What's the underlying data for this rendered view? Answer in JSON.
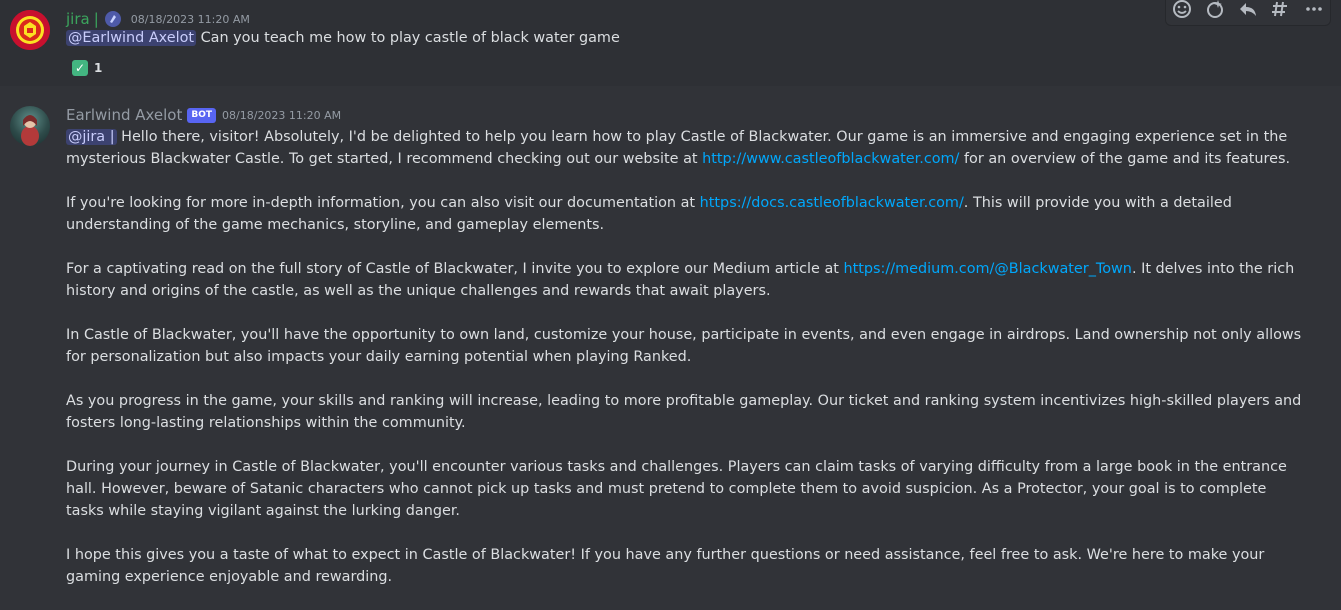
{
  "message1": {
    "username": "jira",
    "separator": "|",
    "timestamp": "08/18/2023 11:20 AM",
    "mention": "@Earlwind Axelot",
    "text": " Can you teach me how to play castle of black water game",
    "reaction": {
      "emoji": "white-check-mark",
      "count": "1"
    },
    "avatar": "manchester-united-crest"
  },
  "toolbar": {
    "icons": [
      "add-reaction-icon",
      "super-reaction-icon",
      "reply-icon",
      "create-thread-icon",
      "more-icon"
    ]
  },
  "message2": {
    "username": "Earlwind Axelot",
    "bot_tag": "BOT",
    "timestamp": "08/18/2023 11:20 AM",
    "mention": "@jira |",
    "p1_a": " Hello there, visitor! Absolutely, I'd be delighted to help you learn how to play Castle of Blackwater. Our game is an immersive and engaging experience set in the mysterious Blackwater Castle. To get started, I recommend checking out our website at ",
    "p1_link": "http://www.castleofblackwater.com/",
    "p1_b": " for an overview of the game and its features.",
    "p2_a": "If you're looking for more in-depth information, you can also visit our documentation at ",
    "p2_link": "https://docs.castleofblackwater.com/",
    "p2_b": ". This will provide you with a detailed understanding of the game mechanics, storyline, and gameplay elements.",
    "p3_a": "For a captivating read on the full story of Castle of Blackwater, I invite you to explore our Medium article at ",
    "p3_link": "https://medium.com/@Blackwater_Town",
    "p3_b": ". It delves into the rich history and origins of the castle, as well as the unique challenges and rewards that await players.",
    "p4": "In Castle of Blackwater, you'll have the opportunity to own land, customize your house, participate in events, and even engage in airdrops. Land ownership not only allows for personalization but also impacts your daily earning potential when playing Ranked.",
    "p5": "As you progress in the game, your skills and ranking will increase, leading to more profitable gameplay. Our ticket and ranking system incentivizes high-skilled players and fosters long-lasting relationships within the community.",
    "p6": "During your journey in Castle of Blackwater, you'll encounter various tasks and challenges. Players can claim tasks of varying difficulty from a large book in the entrance hall. However, beware of Satanic characters who cannot pick up tasks and must pretend to complete them to avoid suspicion. As a Protector, your goal is to complete tasks while staying vigilant against the lurking danger.",
    "p7": "I hope this gives you a taste of what to expect in Castle of Blackwater! If you have any further questions or need assistance, feel free to ask. We're here to make your gaming experience enjoyable and rewarding.",
    "avatar": "anime-character-avatar"
  },
  "colors": {
    "background": "#313338",
    "hover_background": "#2e3035",
    "username_green": "#3ba55d",
    "link": "#00a8fc",
    "mention_bg": "#3c4270",
    "bot_tag": "#5865f2"
  }
}
